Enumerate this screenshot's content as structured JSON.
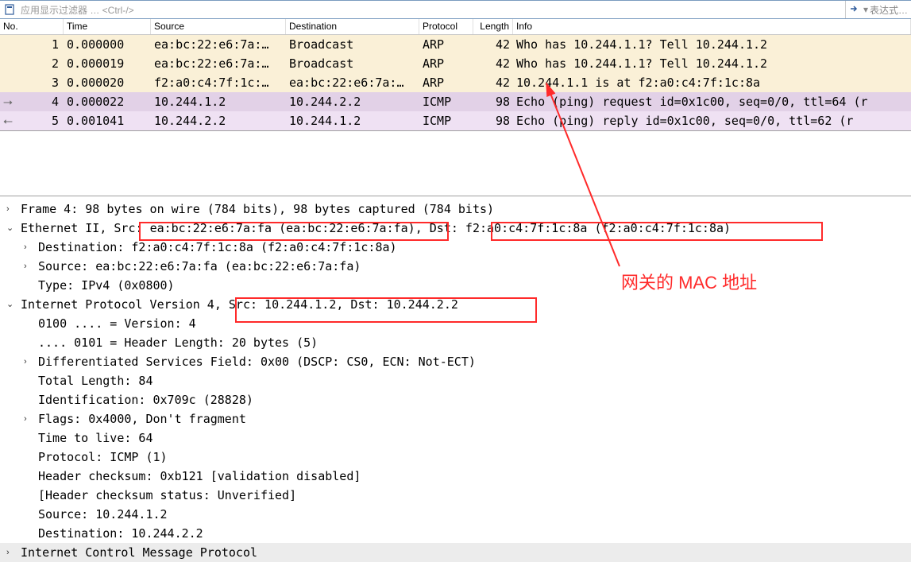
{
  "filter": {
    "placeholder": "应用显示过滤器 … <Ctrl-/>",
    "expression_label": "表达式…"
  },
  "columns": {
    "no": "No.",
    "time": "Time",
    "source": "Source",
    "dest": "Destination",
    "proto": "Protocol",
    "len": "Length",
    "info": "Info"
  },
  "packets": [
    {
      "no": "1",
      "time": "0.000000",
      "src": "ea:bc:22:e6:7a:…",
      "dst": "Broadcast",
      "proto": "ARP",
      "len": "42",
      "info": "Who has 10.244.1.1? Tell 10.244.1.2",
      "cls": "r-arp",
      "dir": ""
    },
    {
      "no": "2",
      "time": "0.000019",
      "src": "ea:bc:22:e6:7a:…",
      "dst": "Broadcast",
      "proto": "ARP",
      "len": "42",
      "info": "Who has 10.244.1.1? Tell 10.244.1.2",
      "cls": "r-arp",
      "dir": ""
    },
    {
      "no": "3",
      "time": "0.000020",
      "src": "f2:a0:c4:7f:1c:…",
      "dst": "ea:bc:22:e6:7a:…",
      "proto": "ARP",
      "len": "42",
      "info": "10.244.1.1 is at f2:a0:c4:7f:1c:8a",
      "cls": "r-arp last",
      "dir": ""
    },
    {
      "no": "4",
      "time": "0.000022",
      "src": "10.244.1.2",
      "dst": "10.244.2.2",
      "proto": "ICMP",
      "len": "98",
      "info": "Echo (ping) request  id=0x1c00, seq=0/0, ttl=64 (r",
      "cls": "r-icmp1",
      "dir": "→"
    },
    {
      "no": "5",
      "time": "0.001041",
      "src": "10.244.2.2",
      "dst": "10.244.1.2",
      "proto": "ICMP",
      "len": "98",
      "info": "Echo (ping) reply    id=0x1c00, seq=0/0, ttl=62 (r",
      "cls": "r-icmp2",
      "dir": "←"
    }
  ],
  "details": {
    "frame": "Frame 4: 98 bytes on wire (784 bits), 98 bytes captured (784 bits)",
    "eth_pre": "Ethernet II, Src: ",
    "eth_src": "ea:bc:22:e6:7a:fa (ea:bc:22:e6:7a:fa),",
    "eth_dst_label": " Dst: ",
    "eth_dst": "f2:a0:c4:7f:1c:8a (f2:a0:c4:7f:1c:8a)",
    "eth_dest_line": "Destination: f2:a0:c4:7f:1c:8a (f2:a0:c4:7f:1c:8a)",
    "eth_src_line": "Source: ea:bc:22:e6:7a:fa (ea:bc:22:e6:7a:fa)",
    "eth_type": "Type: IPv4 (0x0800)",
    "ip_pre": "Internet Protocol Version 4",
    "ip_sd": ", Src: 10.244.1.2, Dst: 10.244.2.2",
    "ip_ver": "0100 .... = Version: 4",
    "ip_hlen": ".... 0101 = Header Length: 20 bytes (5)",
    "ip_dsf": "Differentiated Services Field: 0x00 (DSCP: CS0, ECN: Not-ECT)",
    "ip_tlen": "Total Length: 84",
    "ip_id": "Identification: 0x709c (28828)",
    "ip_flags": "Flags: 0x4000, Don't fragment",
    "ip_ttl": "Time to live: 64",
    "ip_proto": "Protocol: ICMP (1)",
    "ip_hchk": "Header checksum: 0xb121 [validation disabled]",
    "ip_hchks": "[Header checksum status: Unverified]",
    "ip_src": "Source: 10.244.1.2",
    "ip_dst": "Destination: 10.244.2.2",
    "icmp": "Internet Control Message Protocol"
  },
  "annotation": {
    "gateway_mac": "网关的 MAC 地址"
  }
}
